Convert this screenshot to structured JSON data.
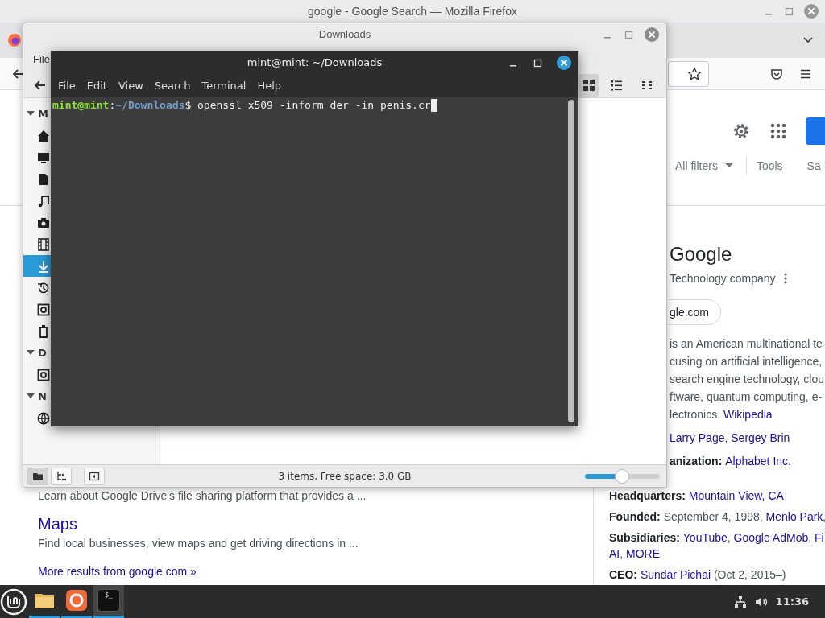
{
  "firefox": {
    "title": "google - Google Search — Mozilla Firefox",
    "google": {
      "filters": [
        {
          "label": "All filters",
          "kind": "dropdown"
        },
        {
          "label": "Tools",
          "kind": "plain"
        },
        {
          "label": "Sa",
          "kind": "plain"
        }
      ],
      "results": [
        {
          "kind": "snippet",
          "text": "Learn about Google Drive's file sharing platform that provides a ..."
        },
        {
          "kind": "title",
          "text": "Maps"
        },
        {
          "kind": "snippet",
          "text": "Find local businesses, view maps and get driving directions in ..."
        },
        {
          "kind": "more",
          "text": "More results from google.com »"
        }
      ],
      "knowledge_panel": {
        "title": "Google",
        "subtitle": "Technology company",
        "website_chip": "gle.com",
        "lines": [
          {
            "parts": [
              {
                "kind": "plain",
                "text": "is an American multinational te"
              }
            ]
          },
          {
            "parts": [
              {
                "kind": "plain",
                "text": "cusing on artificial intelligence,"
              }
            ]
          },
          {
            "parts": [
              {
                "kind": "plain",
                "text": "search engine technology, clou"
              }
            ]
          },
          {
            "parts": [
              {
                "kind": "plain",
                "text": "ftware, quantum computing, e-"
              }
            ]
          },
          {
            "parts": [
              {
                "kind": "plain",
                "text": "lectronics. "
              },
              {
                "kind": "link",
                "text": "Wikipedia"
              }
            ]
          },
          {
            "parts": [
              {
                "kind": "link",
                "text": "Larry Page"
              },
              {
                "kind": "plain",
                "text": ", "
              },
              {
                "kind": "link",
                "text": "Sergey Brin"
              }
            ]
          },
          {
            "parts": [
              {
                "kind": "bold",
                "text": "anization: "
              },
              {
                "kind": "link",
                "text": "Alphabet Inc."
              }
            ]
          }
        ],
        "facts": [
          {
            "parts": [
              {
                "kind": "bold",
                "text": "Headquarters: "
              },
              {
                "kind": "link",
                "text": "Mountain View, CA"
              }
            ]
          },
          {
            "parts": [
              {
                "kind": "bold",
                "text": "Founded: "
              },
              {
                "kind": "plain",
                "text": "September 4, 1998, "
              },
              {
                "kind": "link",
                "text": "Menlo Park"
              },
              {
                "kind": "plain",
                "text": ","
              }
            ]
          },
          {
            "parts": [
              {
                "kind": "bold",
                "text": "Subsidiaries: "
              },
              {
                "kind": "link",
                "text": "YouTube"
              },
              {
                "kind": "plain",
                "text": ", "
              },
              {
                "kind": "link",
                "text": "Google AdMob"
              },
              {
                "kind": "plain",
                "text": ", "
              },
              {
                "kind": "link",
                "text": "Fi"
              }
            ]
          },
          {
            "parts": [
              {
                "kind": "link",
                "text": "AI"
              },
              {
                "kind": "plain",
                "text": ", "
              },
              {
                "kind": "link",
                "text": "MORE"
              }
            ]
          },
          {
            "parts": [
              {
                "kind": "bold",
                "text": "CEO: "
              },
              {
                "kind": "link",
                "text": "Sundar Pichai"
              },
              {
                "kind": "plain",
                "text": " (Oct 2, 2015–)"
              }
            ]
          }
        ]
      }
    }
  },
  "file_manager": {
    "title": "Downloads",
    "menu": [
      "File"
    ],
    "views": [
      {
        "selected": true
      },
      {
        "selected": false
      },
      {
        "selected": false
      }
    ],
    "sidebar": [
      {
        "heading": "M",
        "items": [
          {
            "selected": false
          },
          {
            "selected": false
          },
          {
            "selected": false
          },
          {
            "selected": false
          },
          {
            "selected": false
          },
          {
            "selected": false
          },
          {
            "selected": true
          },
          {
            "selected": false
          },
          {
            "selected": false
          },
          {
            "selected": false
          }
        ]
      },
      {
        "heading": "D",
        "items": [
          {
            "selected": false
          }
        ]
      },
      {
        "heading": "N",
        "items": [
          {
            "selected": false
          }
        ]
      }
    ],
    "status_buttons": [
      {
        "selected": true
      },
      {
        "selected": false
      },
      {
        "selected": false
      }
    ],
    "status": "3 items, Free space: 3.0 GB",
    "zoom": {
      "level": 0.49
    }
  },
  "terminal": {
    "title": "mint@mint: ~/Downloads",
    "menu": [
      "File",
      "Edit",
      "View",
      "Search",
      "Terminal",
      "Help"
    ],
    "prompt": {
      "user": "mint@mint",
      "separator": ":",
      "path": "~/Downloads",
      "symbol": "$",
      "command": "openssl x509 -inform der -in penis.cr"
    }
  },
  "taskbar": {
    "apps": [
      {
        "selected": false
      },
      {
        "selected": false
      },
      {
        "selected": true,
        "label": "$_"
      }
    ],
    "clock": "11:36"
  }
}
